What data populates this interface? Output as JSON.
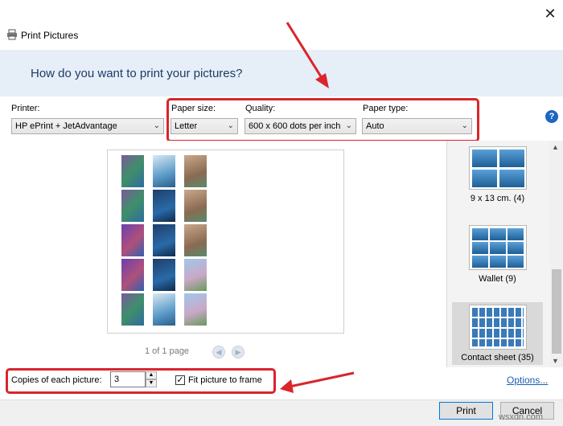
{
  "window": {
    "title": "Print Pictures",
    "close_glyph": "✕"
  },
  "header": {
    "question": "How do you want to print your pictures?"
  },
  "options": {
    "printer_label": "Printer:",
    "printer_value": "HP ePrint + JetAdvantage",
    "paper_size_label": "Paper size:",
    "paper_size_value": "Letter",
    "quality_label": "Quality:",
    "quality_value": "600 x 600 dots per inch",
    "paper_type_label": "Paper type:",
    "paper_type_value": "Auto",
    "help_glyph": "?"
  },
  "preview": {
    "pager_text": "1 of 1 page",
    "prev_glyph": "◀",
    "next_glyph": "▶"
  },
  "layouts": [
    {
      "label": "9 x 13 cm. (4)"
    },
    {
      "label": "Wallet (9)"
    },
    {
      "label": "Contact sheet (35)",
      "selected": true
    }
  ],
  "bottom": {
    "copies_label": "Copies of each picture:",
    "copies_value": "3",
    "fit_label": "Fit picture to frame",
    "fit_checked": true,
    "options_link": "Options..."
  },
  "footer": {
    "print_label": "Print",
    "cancel_label": "Cancel"
  },
  "watermark": "wsxdn.com",
  "colors": {
    "header_band": "#e6eef8",
    "annotation_red": "#d9252b",
    "link_blue": "#1a5fb4"
  }
}
